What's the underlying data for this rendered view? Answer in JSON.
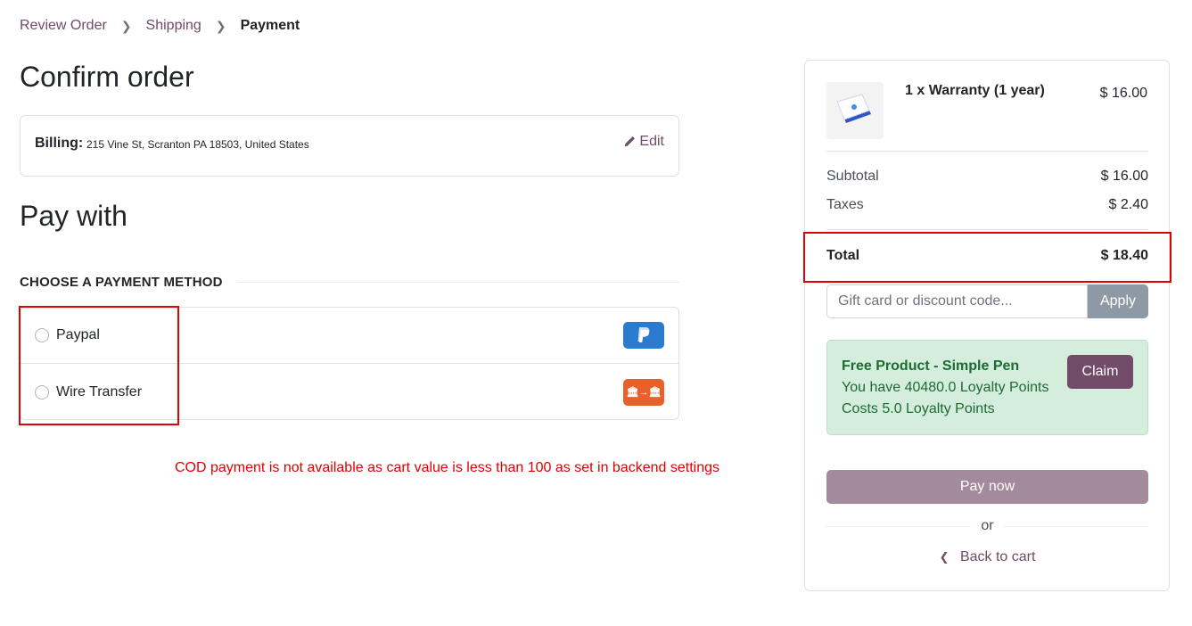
{
  "breadcrumb": {
    "step1": "Review Order",
    "step2": "Shipping",
    "current": "Payment"
  },
  "confirm": {
    "heading": "Confirm order",
    "billing_label": "Billing:",
    "billing_address": "215 Vine St, Scranton PA 18503, United States",
    "edit_label": "Edit"
  },
  "payment": {
    "heading": "Pay with",
    "section_title": "CHOOSE A PAYMENT METHOD",
    "methods": [
      {
        "label": "Paypal",
        "icon": "paypal-icon",
        "color": "#2a7ad0"
      },
      {
        "label": "Wire Transfer",
        "icon": "bank-transfer-icon",
        "color": "#e9612a"
      }
    ],
    "cod_note": "COD payment is not available as cart value is less than 100 as set in backend settings"
  },
  "summary": {
    "item_name": "1 x Warranty (1 year)",
    "item_price": "$ 16.00",
    "subtotal_label": "Subtotal",
    "subtotal_value": "$ 16.00",
    "taxes_label": "Taxes",
    "taxes_value": "$ 2.40",
    "total_label": "Total",
    "total_value": "$ 18.40",
    "coupon_placeholder": "Gift card or discount code...",
    "apply_label": "Apply",
    "loyalty": {
      "title": "Free Product - Simple Pen",
      "line1": "You have 40480.0 Loyalty Points",
      "line2": "Costs 5.0 Loyalty Points",
      "claim_label": "Claim"
    },
    "pay_now_label": "Pay now",
    "or_label": "or",
    "back_label": "Back to cart"
  },
  "colors": {
    "brand": "#714B67",
    "highlight": "#e10000",
    "loyalty_bg": "#d4eddd"
  }
}
